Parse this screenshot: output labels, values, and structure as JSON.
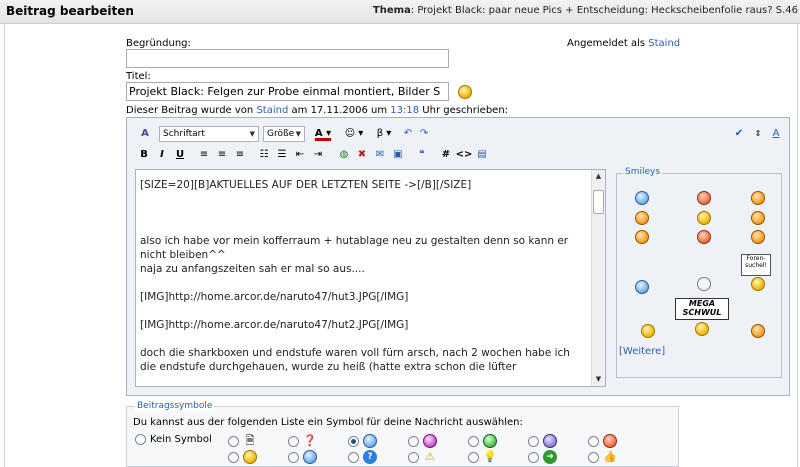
{
  "header": {
    "title": "Beitrag bearbeiten",
    "thema_label": "Thema",
    "thema_value": ": Projekt Black: paar neue Pics + Entscheidung: Heckscheibenfolie raus? S.46"
  },
  "form": {
    "begruendung_label": "Begründung:",
    "begruendung_value": "",
    "logged_in_prefix": "Angemeldet als",
    "logged_in_user": "Staind",
    "titel_label": "Titel:",
    "titel_value": "Projekt Black: Felgen zur Probe einmal montiert, Bilder S",
    "written_prefix": "Dieser Beitrag wurde von",
    "written_user": "Staind",
    "written_mid": "am 17.11.2006 um",
    "written_time": "13:18",
    "written_suffix": "Uhr geschrieben:"
  },
  "toolbar": {
    "font_select": "Schriftart",
    "size_select": "Größe",
    "bold": "B",
    "italic": "I",
    "underline": "U",
    "hash": "#",
    "code": "<>"
  },
  "editor": {
    "lines": [
      "[SIZE=20][B]AKTUELLES AUF DER LETZTEN SEITE ->[/B][/SIZE]",
      "",
      "",
      "",
      "also ich habe vor mein kofferraum + hutablage neu zu gestalten denn so kann er nicht bleiben^^",
      "naja zu anfangszeiten sah er mal so aus....",
      "",
      "[IMG]http://home.arcor.de/naruto47/hut3.JPG[/IMG]",
      "",
      "[IMG]http://home.arcor.de/naruto47/hut2.JPG[/IMG]",
      "",
      "doch die sharkboxen und endstufe waren voll fürn arsch, nach 2 wochen habe ich",
      "die endstufe durchgehauen, wurde zu heiß (hatte extra schon die lüfter"
    ]
  },
  "smileys": {
    "legend": "Smileys",
    "sign_foren": "Foren-suchel!",
    "sign_mega": "MEGA SCHWUL",
    "more_link": "[Weitere]"
  },
  "symbols": {
    "legend": "Beitragssymbole",
    "hint": "Du kannst aus der folgenden Liste ein Symbol für deine Nachricht auswählen:",
    "none_label": "Kein Symbol"
  },
  "colors": {
    "link": "#2c5fa8",
    "header_bg": "#ececec",
    "editor_bg": "#eef1f5"
  }
}
